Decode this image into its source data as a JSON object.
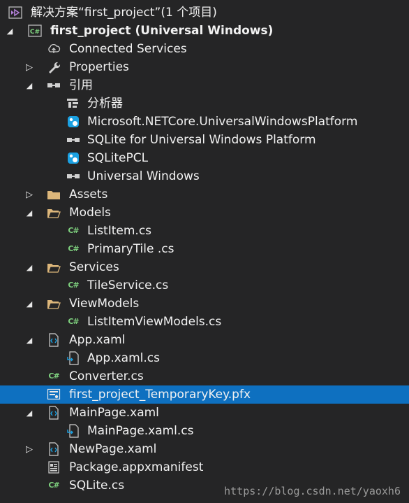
{
  "solution": {
    "label": "解决方案“first_project”(1 个项目)",
    "icon": "solution-icon"
  },
  "project": {
    "label": "first_project (Universal Windows)",
    "icon": "csharp-project-icon"
  },
  "nodes": {
    "connected_services": "Connected Services",
    "properties": "Properties",
    "references": "引用",
    "analyzers": "分析器",
    "ref_netcore": "Microsoft.NETCore.UniversalWindowsPlatform",
    "ref_sqlite_uwp": "SQLite for Universal Windows Platform",
    "ref_sqlitepcl": "SQLitePCL",
    "ref_universal_windows": "Universal Windows",
    "assets": "Assets",
    "models": "Models",
    "listitem_cs": "ListItem.cs",
    "primarytile_cs": "PrimaryTile .cs",
    "services": "Services",
    "tileservice_cs": "TileService.cs",
    "viewmodels": "ViewModels",
    "listitemviewmodels_cs": "ListItemViewModels.cs",
    "app_xaml": "App.xaml",
    "app_xaml_cs": "App.xaml.cs",
    "converter_cs": "Converter.cs",
    "temporary_key": "first_project_TemporaryKey.pfx",
    "mainpage_xaml": "MainPage.xaml",
    "mainpage_xaml_cs": "MainPage.xaml.cs",
    "newpage_xaml": "NewPage.xaml",
    "package_manifest": "Package.appxmanifest",
    "sqlite_cs": "SQLite.cs"
  },
  "watermark": "https://blog.csdn.net/yaoxh6",
  "colors": {
    "background": "#252526",
    "selection": "#0e70c0",
    "folder": "#dcb67a",
    "csharp": "#7ed07e",
    "nuget": "#1ba1e2"
  }
}
